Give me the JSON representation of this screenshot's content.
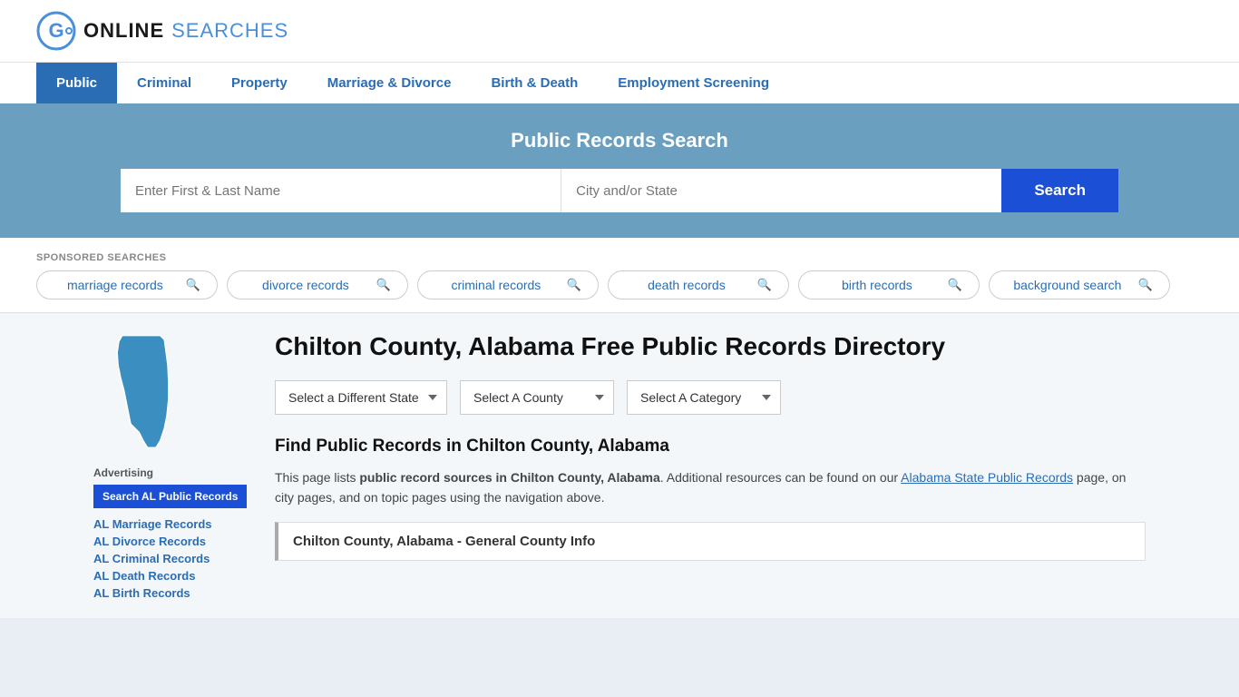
{
  "header": {
    "logo_text_online": "ONLINE",
    "logo_text_searches": "SEARCHES"
  },
  "nav": {
    "items": [
      {
        "label": "Public",
        "active": true
      },
      {
        "label": "Criminal",
        "active": false
      },
      {
        "label": "Property",
        "active": false
      },
      {
        "label": "Marriage & Divorce",
        "active": false
      },
      {
        "label": "Birth & Death",
        "active": false
      },
      {
        "label": "Employment Screening",
        "active": false
      }
    ]
  },
  "search_banner": {
    "title": "Public Records Search",
    "name_placeholder": "Enter First & Last Name",
    "city_placeholder": "City and/or State",
    "search_button": "Search"
  },
  "sponsored": {
    "label": "SPONSORED SEARCHES",
    "pills": [
      {
        "text": "marriage records"
      },
      {
        "text": "divorce records"
      },
      {
        "text": "criminal records"
      },
      {
        "text": "death records"
      },
      {
        "text": "birth records"
      },
      {
        "text": "background search"
      }
    ]
  },
  "sidebar": {
    "ad_label": "Advertising",
    "ad_button": "Search AL Public Records",
    "links": [
      {
        "text": "AL Marriage Records"
      },
      {
        "text": "AL Divorce Records"
      },
      {
        "text": "AL Criminal Records"
      },
      {
        "text": "AL Death Records"
      },
      {
        "text": "AL Birth Records"
      }
    ]
  },
  "main": {
    "page_title": "Chilton County, Alabama Free Public Records Directory",
    "dropdowns": {
      "state": "Select a Different State",
      "county": "Select A County",
      "category": "Select A Category"
    },
    "find_title": "Find Public Records in Chilton County, Alabama",
    "find_text_1": "This page lists ",
    "find_text_bold": "public record sources in Chilton County, Alabama",
    "find_text_2": ". Additional resources can be found on our ",
    "find_link": "Alabama State Public Records",
    "find_text_3": " page, on city pages, and on topic pages using the navigation above.",
    "county_info_bar": "Chilton County, Alabama - General County Info"
  }
}
